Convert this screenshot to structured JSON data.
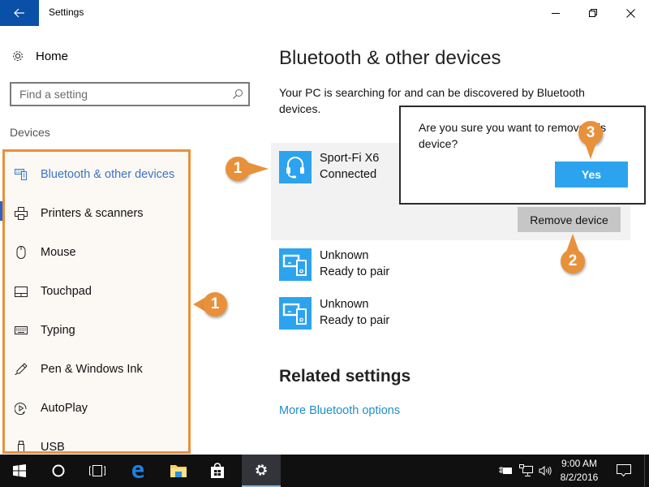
{
  "window": {
    "title": "Settings",
    "controls": [
      "minimize",
      "restore",
      "close"
    ]
  },
  "sidebar": {
    "home_label": "Home",
    "search": {
      "placeholder": "Find a setting",
      "value": ""
    },
    "section_label": "Devices",
    "items": [
      {
        "label": "Bluetooth & other devices",
        "icon": "bluetooth-devices-icon",
        "active": true
      },
      {
        "label": "Printers & scanners",
        "icon": "printer-icon",
        "active": false
      },
      {
        "label": "Mouse",
        "icon": "mouse-icon",
        "active": false
      },
      {
        "label": "Touchpad",
        "icon": "touchpad-icon",
        "active": false
      },
      {
        "label": "Typing",
        "icon": "keyboard-icon",
        "active": false
      },
      {
        "label": "Pen & Windows Ink",
        "icon": "pen-icon",
        "active": false
      },
      {
        "label": "AutoPlay",
        "icon": "autoplay-icon",
        "active": false
      },
      {
        "label": "USB",
        "icon": "usb-icon",
        "active": false
      }
    ]
  },
  "main": {
    "title": "Bluetooth & other devices",
    "description": "Your PC is searching for and can be discovered by Bluetooth devices.",
    "devices": [
      {
        "name": "Sport-Fi X6",
        "status": "Connected",
        "icon": "headset-icon",
        "selected": true
      },
      {
        "name": "Unknown",
        "status": "Ready to pair",
        "icon": "devices-icon",
        "selected": false
      },
      {
        "name": "Unknown",
        "status": "Ready to pair",
        "icon": "devices-icon",
        "selected": false
      }
    ],
    "remove_button": "Remove device",
    "related_title": "Related settings",
    "related_link": "More Bluetooth options"
  },
  "dialog": {
    "message": "Are you sure you want to remove this device?",
    "yes_label": "Yes"
  },
  "callouts": {
    "sidebar_step": "1",
    "device_step": "1",
    "remove_step": "2",
    "yes_step": "3"
  },
  "taskbar": {
    "apps": [
      "start",
      "cortana",
      "task-view",
      "edge",
      "file-explorer",
      "store",
      "settings"
    ],
    "active_app": "settings",
    "time": "9:00 AM",
    "date": "8/2/2016"
  },
  "colors": {
    "accent": "#2ca3ee",
    "back_button": "#0a4fa8",
    "callout": "#e8913a",
    "link": "#1e8fc8",
    "active_nav": "#3a73c8"
  }
}
